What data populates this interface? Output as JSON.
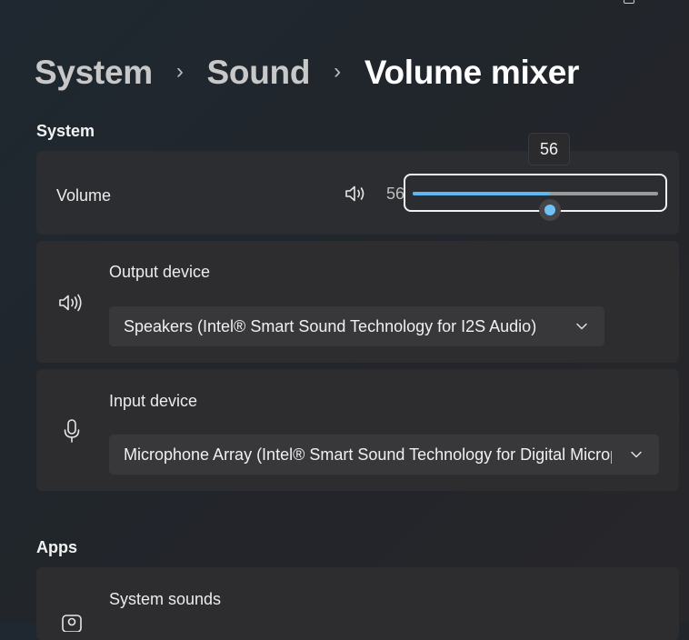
{
  "window": {
    "controls": [
      "maximize-icon",
      "close-icon"
    ]
  },
  "breadcrumb": {
    "items": [
      "System",
      "Sound",
      "Volume mixer"
    ]
  },
  "sections": {
    "system": "System",
    "apps": "Apps"
  },
  "volume": {
    "label": "Volume",
    "value": 56,
    "value_text": "56",
    "tooltip": "56",
    "icon": "speaker-icon"
  },
  "output": {
    "label": "Output device",
    "selected": "Speakers (Intel® Smart Sound Technology for I2S Audio)",
    "icon": "speaker-icon"
  },
  "input": {
    "label": "Input device",
    "selected": "Microphone Array (Intel® Smart Sound Technology for Digital Microphones)",
    "icon": "microphone-icon"
  },
  "apps": {
    "items": [
      {
        "label": "System sounds",
        "icon": "system-sounds-icon"
      }
    ]
  },
  "colors": {
    "accent": "#60b6f0",
    "card": "#2d2d30",
    "background": "#22262b"
  }
}
